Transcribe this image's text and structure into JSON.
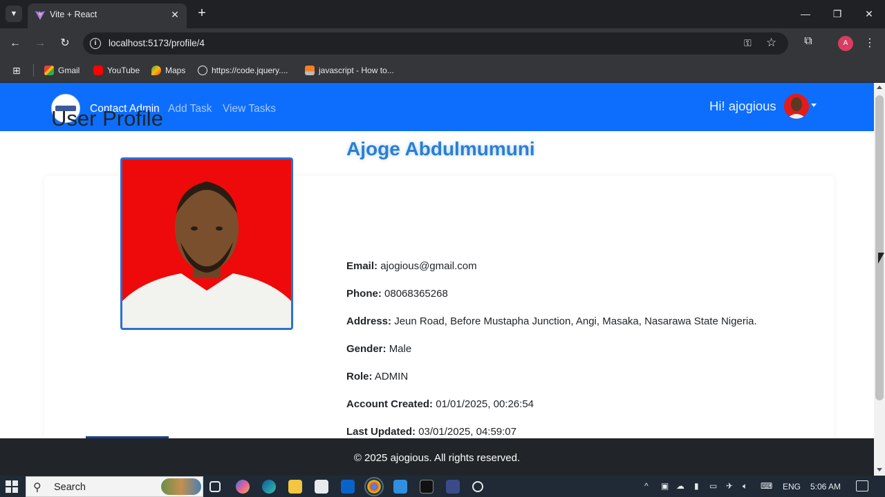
{
  "browser": {
    "tab_title": "Vite + React",
    "url": "localhost:5173/profile/4",
    "profile_initial": "A",
    "bookmarks": [
      {
        "label": "Gmail",
        "icon": "gmail-icon"
      },
      {
        "label": "YouTube",
        "icon": "youtube-icon"
      },
      {
        "label": "Maps",
        "icon": "maps-icon"
      },
      {
        "label": "https://code.jquery....",
        "icon": "globe-icon"
      },
      {
        "label": "javascript - How to...",
        "icon": "stackoverflow-icon"
      }
    ]
  },
  "navbar": {
    "links": [
      "Contact Admin",
      "Add Task",
      "View Tasks"
    ],
    "greeting": "Hi! ajogious"
  },
  "profile": {
    "heading": "User Profile",
    "name": "Ajoge Abdulmumuni",
    "details": [
      {
        "label": "Email:",
        "value": "ajogious@gmail.com"
      },
      {
        "label": "Phone:",
        "value": "08068365268"
      },
      {
        "label": "Address:",
        "value": "Jeun Road, Before Mustapha Junction, Angi, Masaka, Nasarawa State Nigeria."
      },
      {
        "label": "Gender:",
        "value": "Male"
      },
      {
        "label": "Role:",
        "value": "ADMIN"
      },
      {
        "label": "Account Created:",
        "value": "01/01/2025, 00:26:54"
      },
      {
        "label": "Last Updated:",
        "value": "03/01/2025, 04:59:07"
      }
    ]
  },
  "footer": {
    "text": "© 2025 ajogious. All rights reserved."
  },
  "taskbar": {
    "search_label": "Search",
    "language": "ENG",
    "time": "5:06 AM"
  },
  "colors": {
    "navbar": "#0d6efd",
    "name": "#2a7fd4",
    "footer": "#212529",
    "photo_bg": "#ee0a0a"
  }
}
